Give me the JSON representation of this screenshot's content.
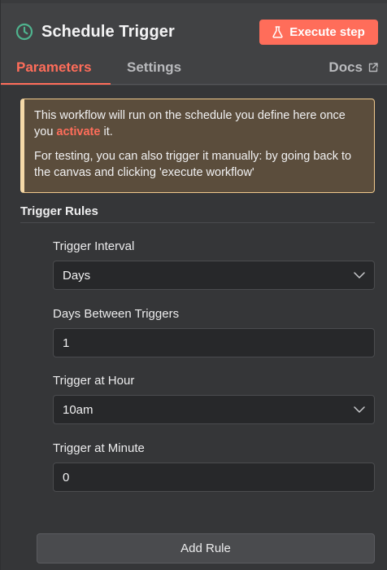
{
  "header": {
    "title": "Schedule Trigger",
    "execute_button": "Execute step",
    "icon": "clock-icon",
    "execute_icon": "flask-icon"
  },
  "tabs": {
    "parameters": "Parameters",
    "settings": "Settings",
    "docs": "Docs",
    "docs_icon": "external-link-icon",
    "active": "Parameters"
  },
  "notice": {
    "line1_before": "This workflow will run on the schedule you define here once you ",
    "link": "activate",
    "line1_after": " it.",
    "line2": "For testing, you can also trigger it manually: by going back to the canvas and clicking 'execute workflow'"
  },
  "section": {
    "title": "Trigger Rules"
  },
  "fields": {
    "interval": {
      "label": "Trigger Interval",
      "value": "Days"
    },
    "days_between": {
      "label": "Days Between Triggers",
      "value": "1"
    },
    "hour": {
      "label": "Trigger at Hour",
      "value": "10am"
    },
    "minute": {
      "label": "Trigger at Minute",
      "value": "0"
    }
  },
  "add_rule": "Add Rule",
  "colors": {
    "accent": "#ff6d5a",
    "panel_bg": "#414244",
    "body_bg": "#353638",
    "notice_bg": "#5b4d3c",
    "notice_border": "#f5d9a8"
  }
}
